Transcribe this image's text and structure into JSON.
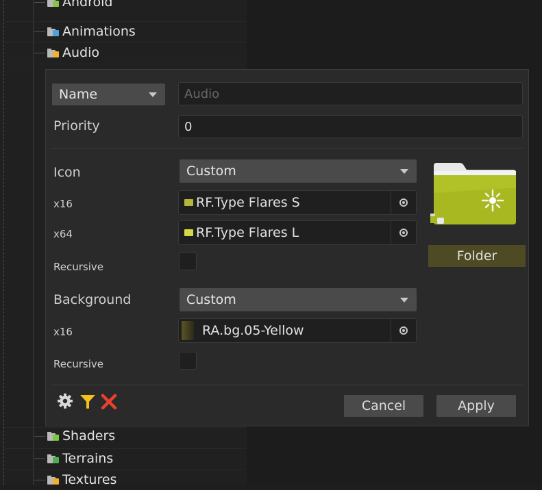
{
  "tree": {
    "items_top": [
      {
        "label": "Android",
        "badge_color": "#8bc34a"
      },
      {
        "label": "Animations",
        "badge_color": "#4aa3df"
      },
      {
        "label": "Audio",
        "badge_color": "#f0b030"
      }
    ],
    "items_bottom": [
      {
        "label": "Shaders",
        "badge_color": "#7ac943"
      },
      {
        "label": "Terrains",
        "badge_color": "#4caf50"
      },
      {
        "label": "Textures",
        "badge_color": "#f0b030"
      }
    ]
  },
  "panel": {
    "name_selector": {
      "value": "Name"
    },
    "name_input": {
      "placeholder": "Audio",
      "value": ""
    },
    "priority": {
      "label": "Priority",
      "value": "0"
    },
    "icon": {
      "label": "Icon",
      "mode": "Custom",
      "x16": {
        "label": "x16",
        "value": "RF.Type Flares S"
      },
      "x64": {
        "label": "x64",
        "value": "RF.Type Flares L"
      },
      "recursive": {
        "label": "Recursive",
        "checked": false
      }
    },
    "background": {
      "label": "Background",
      "mode": "Custom",
      "x16": {
        "label": "x16",
        "value": "RA.bg.05-Yellow",
        "swatch_color": "#4a4420"
      },
      "recursive": {
        "label": "Recursive",
        "checked": false
      }
    },
    "preview": {
      "label": "Folder",
      "folder_color": "#a8b820",
      "label_bg": "#4d4a24"
    },
    "footer": {
      "icons": [
        "gear-icon",
        "filter-icon",
        "close-icon"
      ],
      "cancel_label": "Cancel",
      "apply_label": "Apply"
    }
  },
  "colors": {
    "filter": "#f2c21a",
    "close": "#e8412c",
    "panel_bg": "#2a2a2a"
  }
}
